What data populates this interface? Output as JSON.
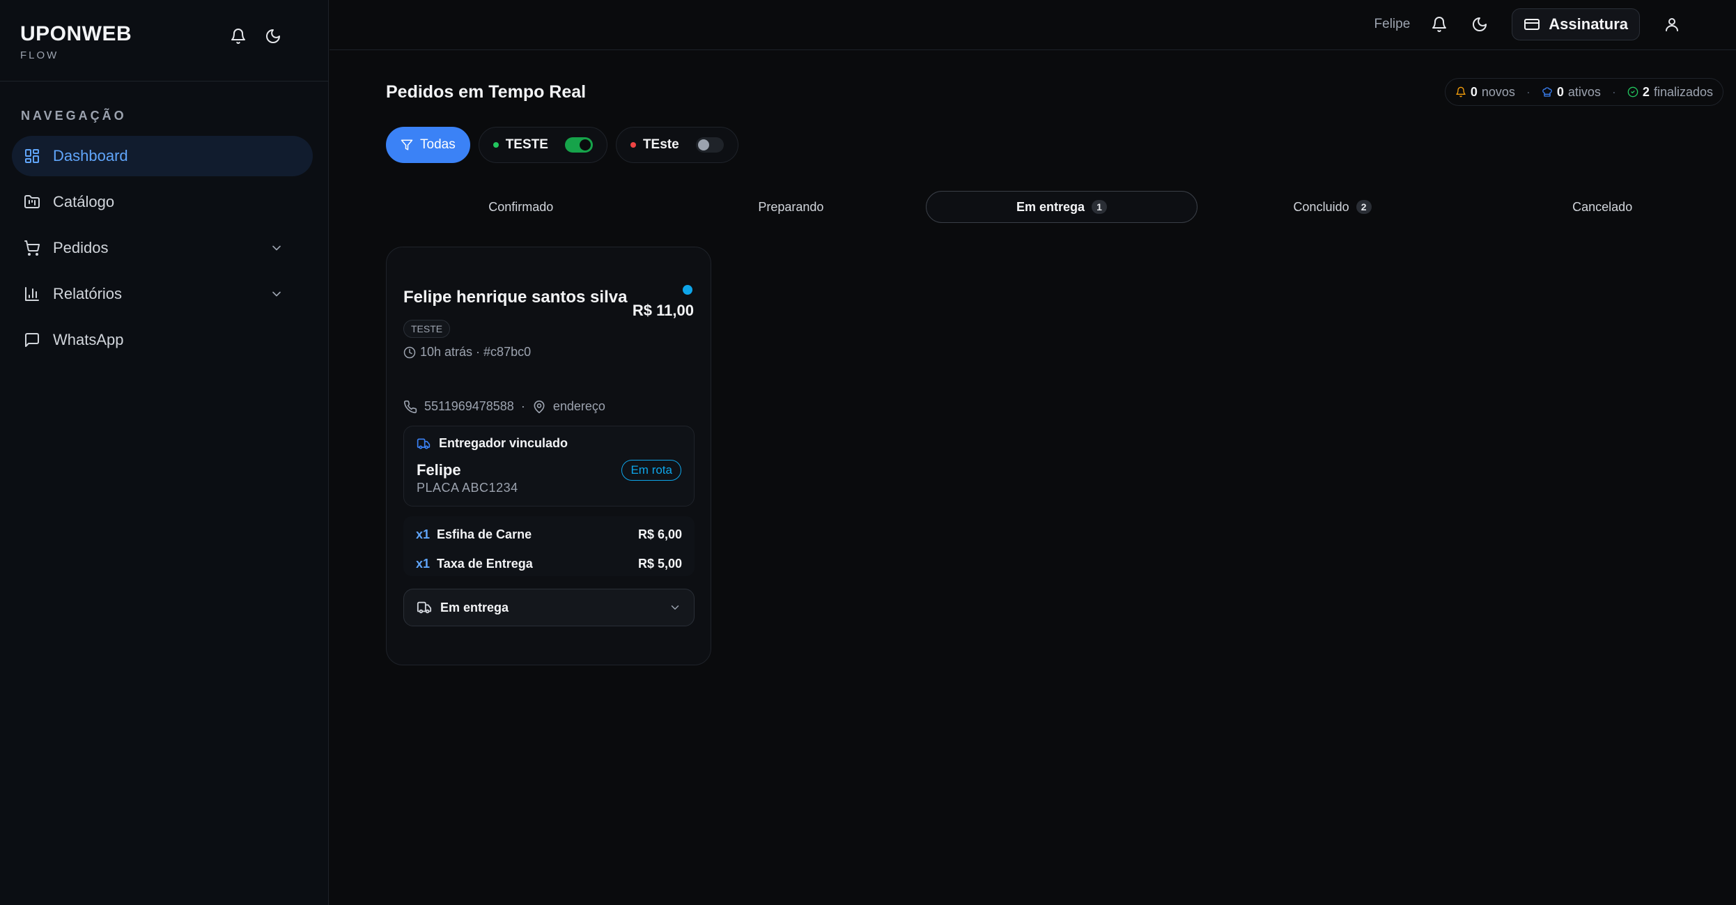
{
  "brand": {
    "name": "UPONWEB",
    "sub": "FLOW"
  },
  "sidebar": {
    "heading": "NAVEGAÇÃO",
    "items": [
      {
        "label": "Dashboard",
        "icon": "dashboard-icon",
        "active": true
      },
      {
        "label": "Catálogo",
        "icon": "catalog-icon"
      },
      {
        "label": "Pedidos",
        "icon": "cart-icon",
        "expandable": true
      },
      {
        "label": "Relatórios",
        "icon": "chart-icon",
        "expandable": true
      },
      {
        "label": "WhatsApp",
        "icon": "message-icon"
      }
    ]
  },
  "topbar": {
    "user": "Felipe",
    "subscription_label": "Assinatura"
  },
  "page": {
    "title": "Pedidos em Tempo Real"
  },
  "stats": {
    "new_count": "0",
    "new_label": "novos",
    "active_count": "0",
    "active_label": "ativos",
    "done_count": "2",
    "done_label": "finalizados"
  },
  "filters": {
    "all_label": "Todas",
    "stores": [
      {
        "label": "TESTE",
        "dot_color": "#22c55e",
        "enabled": true
      },
      {
        "label": "TEste",
        "dot_color": "#ef4444",
        "enabled": false
      }
    ]
  },
  "tabs": [
    {
      "label": "Confirmado",
      "count": ""
    },
    {
      "label": "Preparando",
      "count": ""
    },
    {
      "label": "Em entrega",
      "count": "1",
      "active": true
    },
    {
      "label": "Concluido",
      "count": "2"
    },
    {
      "label": "Cancelado",
      "count": ""
    }
  ],
  "order": {
    "customer": "Felipe henrique santos silva",
    "total": "R$ 11,00",
    "store_tag": "TESTE",
    "time": "10h atrás · #c87bc0",
    "phone": "5511969478588",
    "sep": "·",
    "address": "endereço",
    "courier": {
      "heading": "Entregador vinculado",
      "name": "Felipe",
      "plate": "PLACA ABC1234",
      "status": "Em rota"
    },
    "items": [
      {
        "qty": "x1",
        "name": "Esfiha de Carne",
        "price": "R$ 6,00"
      },
      {
        "qty": "x1",
        "name": "Taxa de Entrega",
        "price": "R$ 5,00"
      }
    ],
    "status_select": "Em entrega"
  },
  "colors": {
    "accent": "#3b82f6",
    "live": "#0ea5e9",
    "on": "#16a34a"
  }
}
